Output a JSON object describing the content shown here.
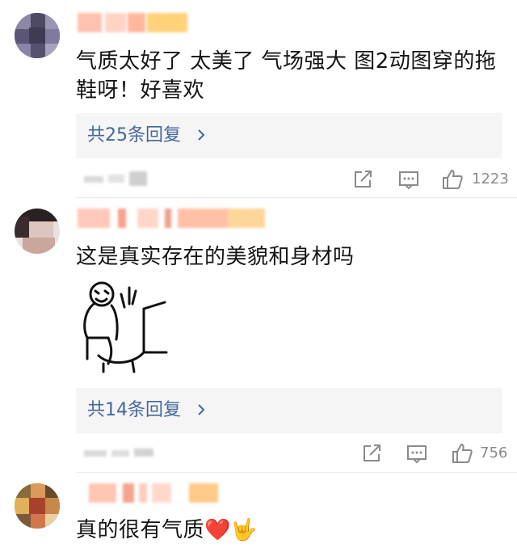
{
  "comments": [
    {
      "text": "气质太好了 太美了 气场强大 图2动图穿的拖鞋呀！好喜欢",
      "reply_label": "共25条回复",
      "like_count": "1223"
    },
    {
      "text": "这是真实存在的美貌和身材吗",
      "reply_label": "共14条回复",
      "like_count": "756"
    },
    {
      "text": "真的很有气质❤️🤟"
    }
  ],
  "icons": {
    "share": "share-icon",
    "comment": "comment-icon",
    "like": "like-icon",
    "chevron": "chevron-right-icon"
  },
  "colors": {
    "reply_link": "#45679b",
    "meta_gray": "#8a8a8a",
    "reply_bg": "#f5f5f5"
  }
}
